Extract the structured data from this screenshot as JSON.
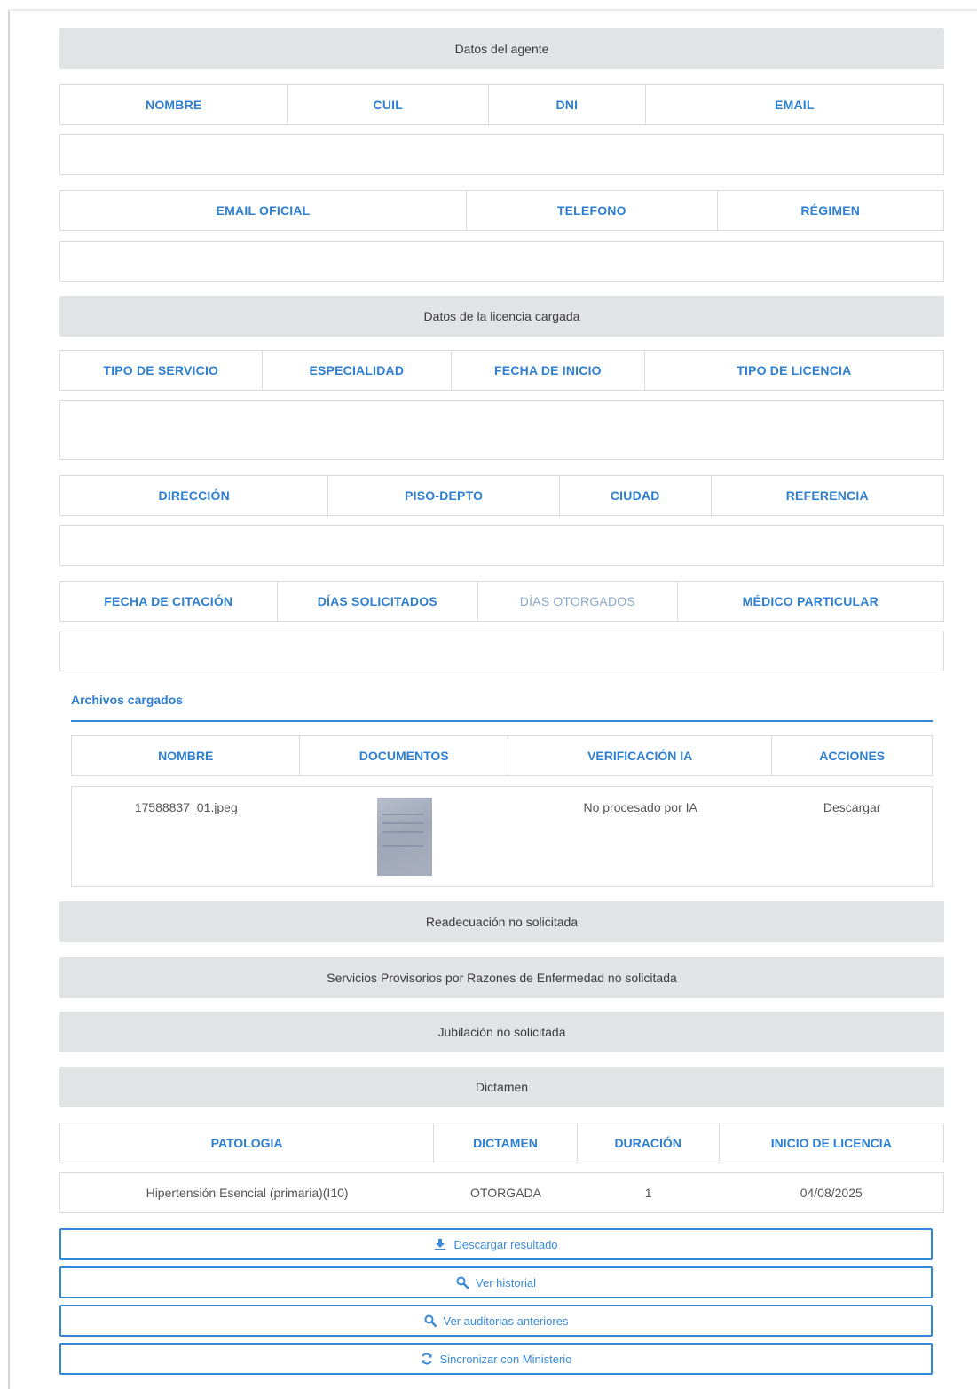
{
  "sections": {
    "agent_title": "Datos del agente",
    "license_title": "Datos de la licencia cargada",
    "readecuacion": "Readecuación no solicitada",
    "servicios": "Servicios Provisorios por Razones de Enfermedad no solicitada",
    "jubilacion": "Jubilación no solicitada",
    "dictamen_title": "Dictamen"
  },
  "agent_headers_1": [
    "NOMBRE",
    "CUIL",
    "DNI",
    "EMAIL"
  ],
  "agent_headers_2": [
    "EMAIL OFICIAL",
    "TELEFONO",
    "RÉGIMEN"
  ],
  "license_headers_1": [
    "TIPO DE SERVICIO",
    "ESPECIALIDAD",
    "FECHA DE INICIO",
    "TIPO DE LICENCIA"
  ],
  "license_headers_2": [
    "DIRECCIÓN",
    "PISO-DEPTO",
    "CIUDAD",
    "REFERENCIA"
  ],
  "license_headers_3": [
    "FECHA DE CITACIÓN",
    "DÍAS SOLICITADOS",
    "DÍAS OTORGADOS",
    "MÉDICO PARTICULAR"
  ],
  "files": {
    "title": "Archivos cargados",
    "headers": [
      "NOMBRE",
      "DOCUMENTOS",
      "VERIFICACIÓN IA",
      "ACCIONES"
    ],
    "row": {
      "nombre": "17588837_01.jpeg",
      "verificacion": "No procesado por IA",
      "accion": "Descargar"
    }
  },
  "dictamen": {
    "headers": [
      "PATOLOGIA",
      "DICTAMEN",
      "DURACIÓN",
      "INICIO DE LICENCIA"
    ],
    "row": [
      "Hipertensión Esencial (primaria)(I10)",
      "OTORGADA",
      "1",
      "04/08/2025"
    ]
  },
  "buttons": {
    "descargar_resultado": "Descargar resultado",
    "ver_historial": "Ver historial",
    "ver_auditorias": "Ver auditorias anteriores",
    "sincronizar": "Sincronizar con Ministerio"
  },
  "icons": {
    "download": "download-icon",
    "search": "search-icon",
    "sync": "sync-icon"
  },
  "colors": {
    "accent": "#2f7fd0",
    "band": "#e2e3e4",
    "border": "#dcdcdc"
  }
}
